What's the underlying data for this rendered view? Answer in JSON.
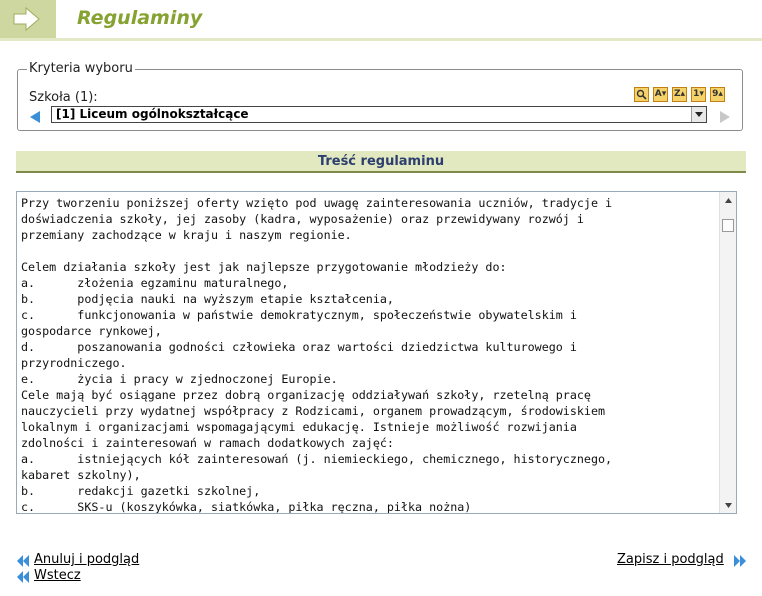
{
  "header": {
    "title": "Regulaminy",
    "accent": "#86a231",
    "arrow_icon": "arrow-right-icon"
  },
  "filters": {
    "legend": "Kryteria wyboru",
    "school_label": "Szkoła (1):",
    "school_selected": "[1] Liceum ogólnokształcące",
    "sort_icons": [
      "search-icon",
      "A",
      "Z",
      "1",
      "9"
    ]
  },
  "section": {
    "title": "Treść regulaminu"
  },
  "content": {
    "lines": [
      "Przy tworzeniu poniższej oferty wzięto pod uwagę zainteresowania uczniów, tradycje i",
      "doświadczenia szkoły, jej zasoby (kadra, wyposażenie) oraz przewidywany rozwój i",
      "przemiany zachodzące w kraju i naszym regionie.",
      "",
      "Celem działania szkoły jest jak najlepsze przygotowanie młodzieży do:",
      "a.      złożenia egzaminu maturalnego,",
      "b.      podjęcia nauki na wyższym etapie kształcenia,",
      "c.      funkcjonowania w państwie demokratycznym, społeczeństwie obywatelskim i",
      "gospodarce rynkowej,",
      "d.      poszanowania godności człowieka oraz wartości dziedzictwa kulturowego i",
      "przyrodniczego.",
      "e.      życia i pracy w zjednoczonej Europie.",
      "Cele mają być osiągane przez dobrą organizację oddziaływań szkoły, rzetelną pracę",
      "nauczycieli przy wydatnej współpracy z Rodzicami, organem prowadzącym, środowiskiem",
      "lokalnym i organizacjami wspomagającymi edukację. Istnieje możliwość rozwijania",
      "zdolności i zainteresowań w ramach dodatkowych zajęć:",
      "a.      istniejących kół zainteresowań (j. niemieckiego, chemicznego, historycznego,",
      "kabaret szkolny),",
      "b.      redakcji gazetki szkolnej,",
      "c.      SKS-u (koszykówka, siatkówka, piłka ręczna, piłka nożna)"
    ]
  },
  "actions": {
    "cancel_preview": "Anuluj i podgląd",
    "back": "Wstecz",
    "save_preview": "Zapisz i podgląd"
  }
}
